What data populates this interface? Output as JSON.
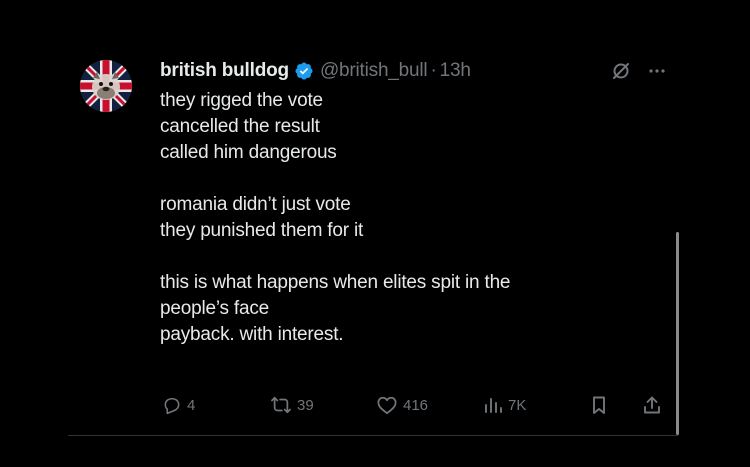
{
  "tweet": {
    "author": {
      "name": "british bulldog",
      "handle": "@british_bull",
      "separator": "·",
      "time": "13h"
    },
    "body_lines": [
      "they rigged the vote",
      "cancelled the result",
      "called him dangerous",
      "",
      "romania didn’t just vote",
      "they punished them for it",
      "",
      "this is what happens when elites spit in the",
      "people’s face",
      "payback. with interest."
    ],
    "stats": {
      "replies": "4",
      "reposts": "39",
      "likes": "416",
      "views": "7K"
    }
  },
  "icons": {
    "verified": "verified-badge-icon",
    "grok": "grok-icon",
    "more": "more-icon",
    "reply": "reply-icon",
    "repost": "repost-icon",
    "like": "like-icon",
    "views": "views-icon",
    "bookmark": "bookmark-icon",
    "share": "share-icon"
  },
  "colors": {
    "background": "#000000",
    "text": "#e7e9ea",
    "secondary": "#71767b",
    "verified": "#1d9bf0"
  }
}
